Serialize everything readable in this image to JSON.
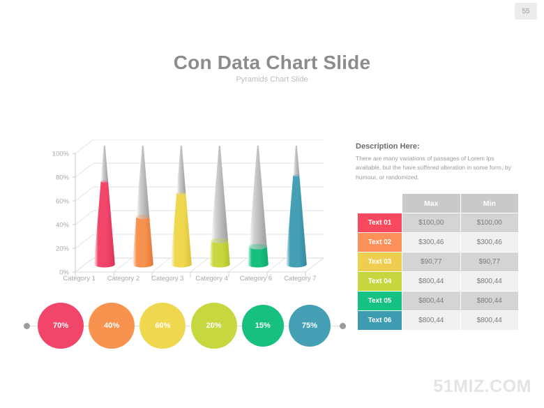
{
  "page": {
    "number": "55"
  },
  "header": {
    "title": "Con Data Chart Slide",
    "subtitle": "Pyramids Chart Slide"
  },
  "description": {
    "heading": "Description Here:",
    "body": "There are many variations of passages  of Lorem Ips available, but the have suffered alteration in some form, by humour, or randomized."
  },
  "chart_data": {
    "type": "bar",
    "title": "Con Data Chart Slide",
    "subtitle": "Pyramids Chart Slide",
    "xlabel": "",
    "ylabel": "",
    "ylim": [
      0,
      100
    ],
    "ytick_labels": [
      "100%",
      "80%",
      "60%",
      "40%",
      "20%",
      "0%"
    ],
    "yticks": [
      100,
      80,
      60,
      40,
      20,
      0
    ],
    "grid": true,
    "legend": "none",
    "style": "3d-cone",
    "categories": [
      "Category 1",
      "Category 2",
      "Category 3",
      "Category 4",
      "Category 6",
      "Category 7"
    ],
    "values": [
      70,
      40,
      60,
      20,
      15,
      75
    ],
    "colors": [
      "#F2456A",
      "#F7924F",
      "#EDD košt"
    ]
  },
  "chart": {
    "y_ticks": [
      "100%",
      "80%",
      "60%",
      "40%",
      "20%",
      "0%"
    ],
    "categories": [
      "Category 1",
      "Category 2",
      "Category 3",
      "Category 4",
      "Category 6",
      "Category 7"
    ],
    "cones": [
      {
        "label": "Category 1",
        "value": 70,
        "color": "#F2456A",
        "color_dark": "#D93358",
        "empty": "#D2D2D2",
        "empty_dark": "#B8B8B8"
      },
      {
        "label": "Category 2",
        "value": 40,
        "color": "#F7924F",
        "color_dark": "#E0783B",
        "empty": "#D2D2D2",
        "empty_dark": "#B8B8B8"
      },
      {
        "label": "Category 3",
        "value": 60,
        "color": "#EFD850",
        "color_dark": "#DCC23C",
        "empty": "#D2D2D2",
        "empty_dark": "#B8B8B8"
      },
      {
        "label": "Category 4",
        "value": 20,
        "color": "#C7D73F",
        "color_dark": "#B1C32C",
        "empty": "#D2D2D2",
        "empty_dark": "#B8B8B8"
      },
      {
        "label": "Category 6",
        "value": 15,
        "color": "#17C07E",
        "color_dark": "#0FA96C",
        "empty": "#D2D2D2",
        "empty_dark": "#B8B8B8"
      },
      {
        "label": "Category 7",
        "value": 75,
        "color": "#45A0B5",
        "color_dark": "#35899D",
        "empty": "#D2D2D2",
        "empty_dark": "#B8B8B8"
      }
    ]
  },
  "circles": [
    {
      "label": "70%",
      "color": "#F2456A",
      "size": "big"
    },
    {
      "label": "40%",
      "color": "#F7924F",
      "size": "big"
    },
    {
      "label": "60%",
      "color": "#EFD850",
      "size": "big"
    },
    {
      "label": "20%",
      "color": "#C7D73F",
      "size": "big"
    },
    {
      "label": "15%",
      "color": "#17C07E",
      "size": "normal"
    },
    {
      "label": "75%",
      "color": "#45A0B5",
      "size": "normal"
    }
  ],
  "table": {
    "headers": [
      "",
      "Max",
      "Min"
    ],
    "rows": [
      {
        "label": "Text 01",
        "color": "#F9495F",
        "max": "$100,00",
        "min": "$100,00"
      },
      {
        "label": "Text 02",
        "color": "#FB9158",
        "max": "$300,46",
        "min": "$300,46"
      },
      {
        "label": "Text 03",
        "color": "#EFCE4F",
        "max": "$90,77",
        "min": "$90,77"
      },
      {
        "label": "Text 04",
        "color": "#C5D63F",
        "max": "$800,44",
        "min": "$800,44"
      },
      {
        "label": "Text 05",
        "color": "#15C183",
        "max": "$800,44",
        "min": "$800,44"
      },
      {
        "label": "Text 06",
        "color": "#3E9CB2",
        "max": "$800,44",
        "min": "$800,44"
      }
    ]
  },
  "watermark": {
    "text": "51MIZ.COM"
  }
}
